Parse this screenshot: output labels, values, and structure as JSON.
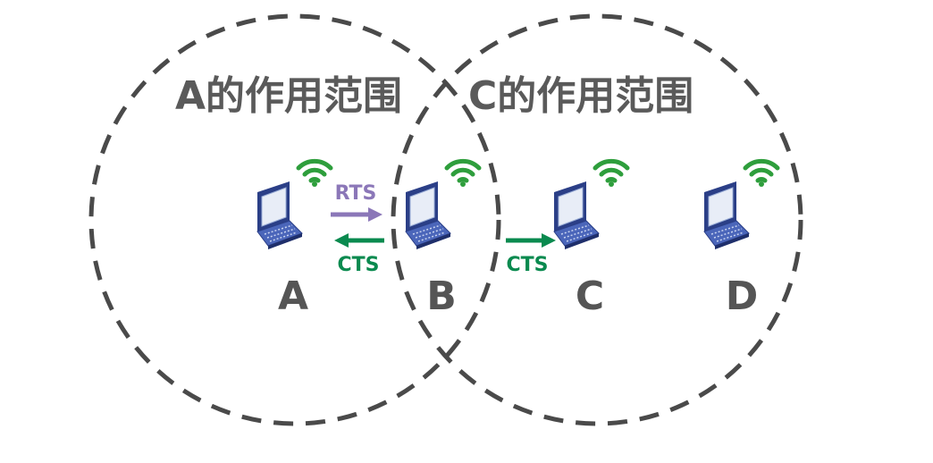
{
  "ranges": [
    {
      "id": "a-range",
      "title": "A的作用范围"
    },
    {
      "id": "c-range",
      "title": "C的作用范围"
    }
  ],
  "nodes": [
    {
      "id": "a",
      "label": "A"
    },
    {
      "id": "b",
      "label": "B"
    },
    {
      "id": "c",
      "label": "C"
    },
    {
      "id": "d",
      "label": "D"
    }
  ],
  "messages": {
    "rts_a_to_b": "RTS",
    "cts_b_to_a": "CTS",
    "cts_b_to_c": "CTS"
  },
  "colors": {
    "circle": "#4a4a4a",
    "rts": "#8b77b8",
    "cts": "#0a8a4f",
    "wifi": "#2e9e3c",
    "laptop": "#3b55a8"
  },
  "icons": [
    "laptop-icon",
    "wifi-signal-icon",
    "arrow-right-icon",
    "arrow-left-icon"
  ]
}
